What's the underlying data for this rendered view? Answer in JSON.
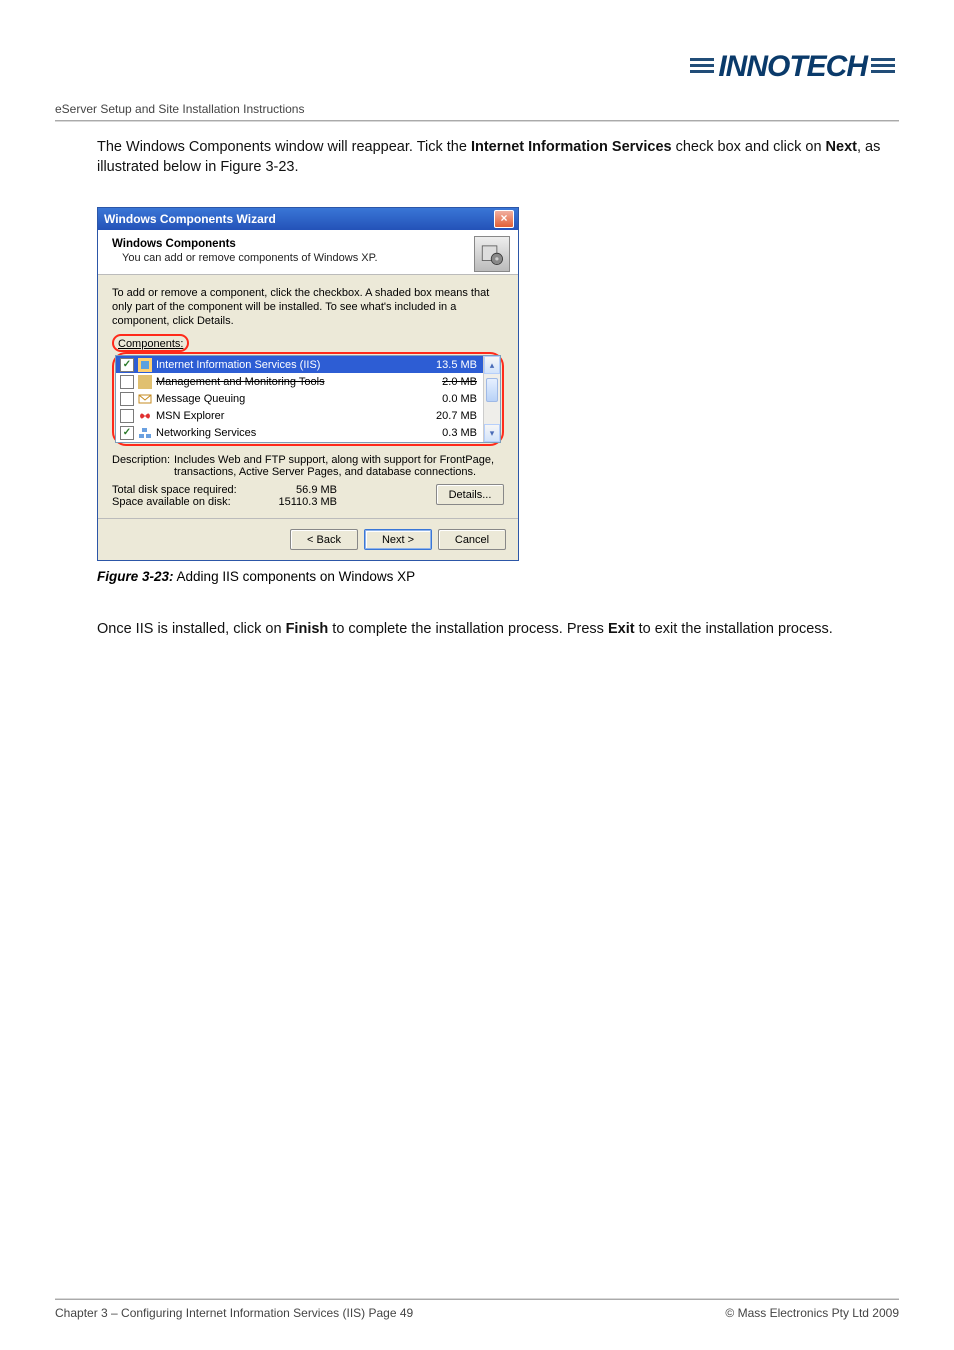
{
  "logo_text": "INNOTECH",
  "doc_title": "eServer Setup and Site Installation Instructions",
  "para1": {
    "t1": "The Windows Components window will reappear.  Tick the ",
    "b1": "Internet Information Services",
    "t2": " check box and click on ",
    "b2": "Next",
    "t3": ", as illustrated below in Figure 3-23."
  },
  "wizard": {
    "title": "Windows Components Wizard",
    "header_title": "Windows Components",
    "header_sub": "You can add or remove components of Windows XP.",
    "instruction": "To add or remove a component, click the checkbox.  A shaded box means that only part of the component will be installed.  To see what's included in a component, click Details.",
    "components_label": "Components:",
    "rows": [
      {
        "checked": true,
        "selected": true,
        "strike": false,
        "name": "Internet Information Services (IIS)",
        "size": "13.5 MB"
      },
      {
        "checked": false,
        "selected": false,
        "strike": true,
        "name": "Management and Monitoring Tools",
        "size": "2.0 MB"
      },
      {
        "checked": false,
        "selected": false,
        "strike": false,
        "name": "Message Queuing",
        "size": "0.0 MB"
      },
      {
        "checked": false,
        "selected": false,
        "strike": false,
        "name": "MSN Explorer",
        "size": "20.7 MB"
      },
      {
        "checked": true,
        "selected": false,
        "strike": false,
        "name": "Networking Services",
        "size": "0.3 MB"
      }
    ],
    "desc_label": "Description:",
    "desc_text": "Includes Web and FTP support, along with support for FrontPage, transactions, Active Server Pages, and database connections.",
    "space_required_label": "Total disk space required:",
    "space_required_value": "56.9 MB",
    "space_available_label": "Space available on disk:",
    "space_available_value": "15110.3 MB",
    "details_btn": "Details...",
    "back_btn": "< Back",
    "next_btn": "Next >",
    "cancel_btn": "Cancel"
  },
  "caption": {
    "label": "Figure 3-23:",
    "text": "   Adding IIS components on Windows XP"
  },
  "para2": {
    "t1": "Once IIS is installed, click on ",
    "b1": "Finish",
    "t2": " to complete the installation process.  Press ",
    "b2": "Exit",
    "t3": " to exit the installation process."
  },
  "footer": {
    "left": "Chapter 3 – Configuring Internet Information Services (IIS)      Page 49",
    "right": "© Mass Electronics Pty Ltd  2009"
  }
}
